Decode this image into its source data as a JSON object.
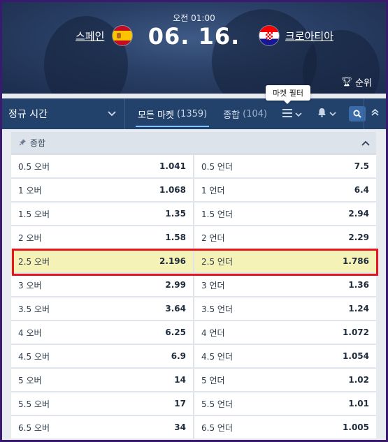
{
  "header": {
    "kickoff_time": "오전 01:00",
    "date": "06. 16.",
    "home_team": "스페인",
    "away_team": "크로아티아",
    "ranking_label": "순위"
  },
  "tabbar": {
    "period_label": "정규 시간",
    "tabs": [
      {
        "label": "모든 마켓",
        "count": "(1359)"
      },
      {
        "label": "종합",
        "count": "(104)"
      }
    ],
    "tooltip": "마켓 필터"
  },
  "market": {
    "title": "종합",
    "rows": [
      {
        "over_label": "0.5 오버",
        "over_odds": "1.041",
        "under_label": "0.5 언더",
        "under_odds": "7.5"
      },
      {
        "over_label": "1 오버",
        "over_odds": "1.068",
        "under_label": "1 언더",
        "under_odds": "6.4"
      },
      {
        "over_label": "1.5 오버",
        "over_odds": "1.35",
        "under_label": "1.5 언더",
        "under_odds": "2.94"
      },
      {
        "over_label": "2 오버",
        "over_odds": "1.58",
        "under_label": "2 언더",
        "under_odds": "2.29"
      },
      {
        "over_label": "2.5 오버",
        "over_odds": "2.196",
        "under_label": "2.5 언더",
        "under_odds": "1.786"
      },
      {
        "over_label": "3 오버",
        "over_odds": "2.99",
        "under_label": "3 언더",
        "under_odds": "1.36"
      },
      {
        "over_label": "3.5 오버",
        "over_odds": "3.64",
        "under_label": "3.5 언더",
        "under_odds": "1.24"
      },
      {
        "over_label": "4 오버",
        "over_odds": "6.25",
        "under_label": "4 언더",
        "under_odds": "1.072"
      },
      {
        "over_label": "4.5 오버",
        "over_odds": "6.9",
        "under_label": "4.5 언더",
        "under_odds": "1.054"
      },
      {
        "over_label": "5 오버",
        "over_odds": "14",
        "under_label": "5 언더",
        "under_odds": "1.02"
      },
      {
        "over_label": "5.5 오버",
        "over_odds": "17",
        "under_label": "5.5 언더",
        "under_odds": "1.01"
      },
      {
        "over_label": "6.5 오버",
        "over_odds": "34",
        "under_label": "6.5 언더",
        "under_odds": "1.005"
      }
    ]
  },
  "colors": {
    "tabbar_bg": "#22426c",
    "highlight_border": "#e8141e",
    "highlight_fill": "#f5f2b8",
    "page_frame": "#3a1a6e"
  }
}
